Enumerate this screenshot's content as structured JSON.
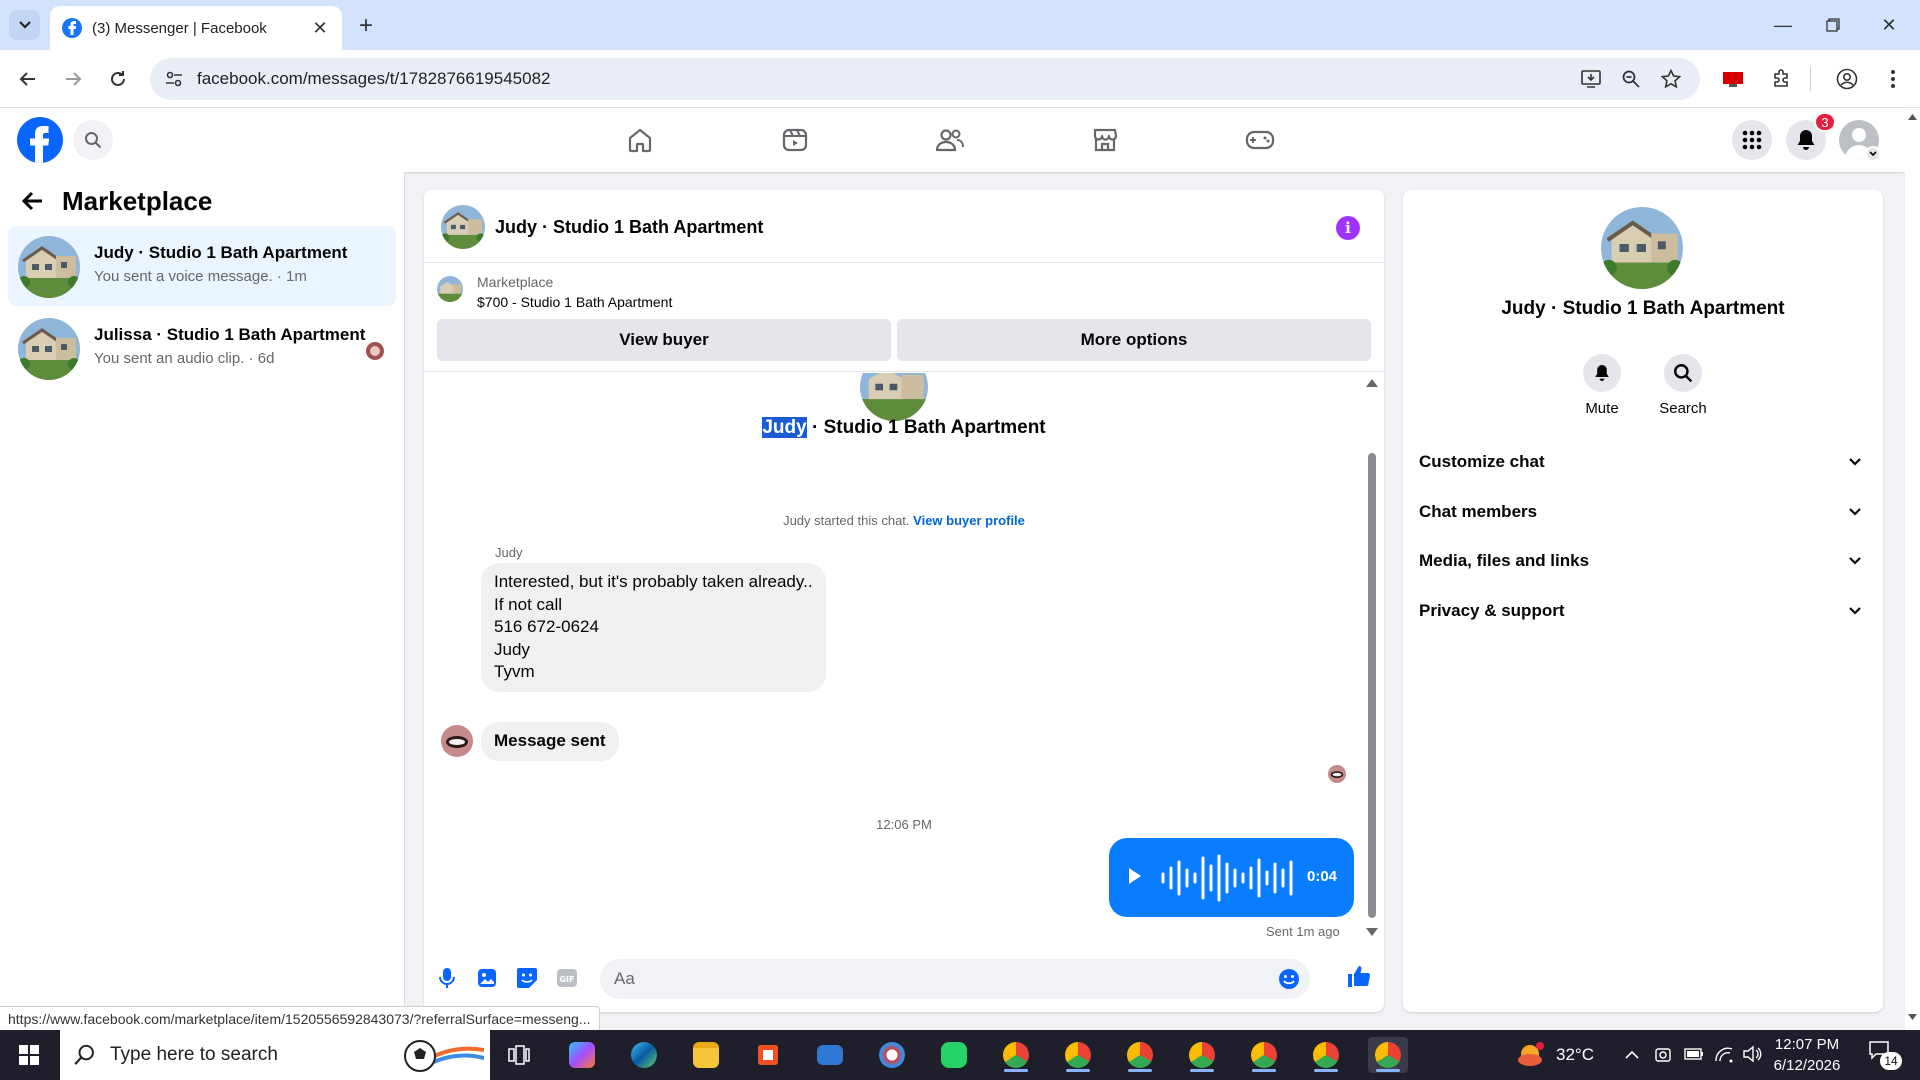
{
  "browser": {
    "tab_title": "(3) Messenger | Facebook",
    "url": "facebook.com/messages/t/1782876619545082"
  },
  "fb": {
    "notification_count": "3",
    "brand_color": "#0866ff"
  },
  "sidebar": {
    "title": "Marketplace",
    "conversations": [
      {
        "name": "Judy · Studio 1 Bath Apartment",
        "preview": "You sent a voice message. · 1m"
      },
      {
        "name": "Julissa · Studio 1 Bath Apartment",
        "preview": "You sent an audio clip. · 6d"
      }
    ]
  },
  "chat": {
    "header_title": "Judy · Studio 1 Bath Apartment",
    "marketplace_label": "Marketplace",
    "listing": "$700 - Studio 1 Bath Apartment",
    "view_buyer": "View buyer",
    "more_options": "More options",
    "title_highlight": "Judy",
    "title_rest": " · Studio 1 Bath Apartment",
    "started_text": "Judy started this chat.",
    "started_link": "View buyer profile",
    "sender": "Judy",
    "message_lines": [
      "Interested, but it's probably taken already..",
      "If not call",
      "516 672-0624",
      "Judy",
      "Tyvm"
    ],
    "message_sent": "Message sent",
    "timestamp": "12:06 PM",
    "voice_duration": "0:04",
    "sent_label": "Sent 1m ago",
    "composer_placeholder": "Aa",
    "voice_color": "#0a7cff"
  },
  "details": {
    "name": "Judy · Studio 1 Bath Apartment",
    "mute": "Mute",
    "search": "Search",
    "sections": [
      "Customize chat",
      "Chat members",
      "Media, files and links",
      "Privacy & support"
    ]
  },
  "status_url": "https://www.facebook.com/marketplace/item/1520556592843073/?referralSurface=messeng...",
  "taskbar": {
    "search_placeholder": "Type here to search",
    "temperature": "32°C",
    "time": "12:07 PM",
    "date": "6/12/2026",
    "notifications": "14"
  }
}
